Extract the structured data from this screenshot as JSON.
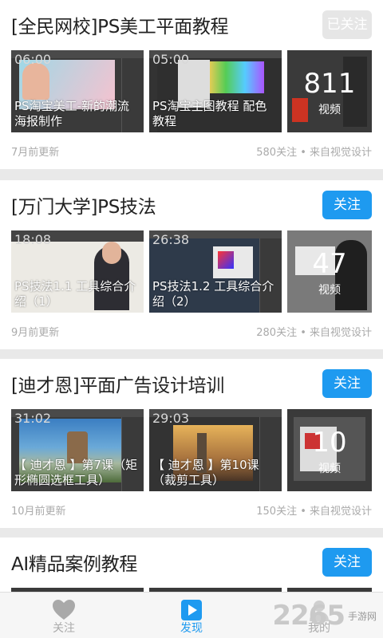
{
  "channels": [
    {
      "title": "[全民网校]PS美工平面教程",
      "follow_label": "已关注",
      "followed": true,
      "videos": [
        {
          "duration": "06:00",
          "caption": "PS淘宝美工-新的潮流海报制作"
        },
        {
          "duration": "05:00",
          "caption": "PS淘宝主图教程 配色教程"
        }
      ],
      "video_count": "811",
      "video_count_label": "视频",
      "updated": "7月前更新",
      "stats": "580关注 • 来自视觉设计"
    },
    {
      "title": "[万门大学]PS技法",
      "follow_label": "关注",
      "followed": false,
      "videos": [
        {
          "duration": "18:08",
          "caption": "PS技法1.1 工具综合介绍（1）"
        },
        {
          "duration": "26:38",
          "caption": "PS技法1.2 工具综合介绍（2）"
        }
      ],
      "video_count": "47",
      "video_count_label": "视频",
      "updated": "9月前更新",
      "stats": "280关注 • 来自视觉设计"
    },
    {
      "title": "[迪才恩]平面广告设计培训",
      "follow_label": "关注",
      "followed": false,
      "videos": [
        {
          "duration": "31:02",
          "caption": "【 迪才恩 】第7课（矩形椭圆选框工具）"
        },
        {
          "duration": "29:03",
          "caption": "【 迪才恩 】第10课（裁剪工具）"
        }
      ],
      "video_count": "10",
      "video_count_label": "视频",
      "updated": "10月前更新",
      "stats": "150关注 • 来自视觉设计"
    },
    {
      "title": "AI精品案例教程",
      "follow_label": "关注",
      "followed": false
    }
  ],
  "tabbar": {
    "items": [
      {
        "label": "关注",
        "icon": "heart-icon"
      },
      {
        "label": "发现",
        "icon": "play-icon"
      },
      {
        "label": "我的",
        "icon": "user-icon"
      }
    ],
    "active_index": 1
  },
  "watermark": {
    "number": "2265",
    "text": "手游网"
  },
  "colors": {
    "accent": "#1e9af0",
    "followed_button": "#e6e6e6",
    "muted_text": "#aaaaaa"
  }
}
